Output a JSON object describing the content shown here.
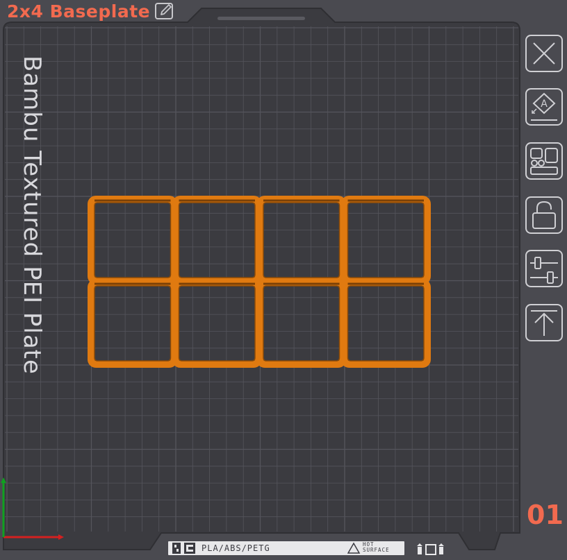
{
  "window": {
    "title": "2x4 Baseplate",
    "title_color": "#f26a4f"
  },
  "plate": {
    "name": "Bambu Textured PEI Plate",
    "index": "01",
    "index_color": "#f26a4f",
    "bed_color": "#3b3b40",
    "grid_color": "#55555c",
    "model_color": "#e07a10",
    "model_name": "2x4 Baseplate",
    "model_rows": 2,
    "model_cols": 4
  },
  "side_toolbar": [
    {
      "name": "close-plate-button",
      "icon": "close-icon"
    },
    {
      "name": "auto-orient-button",
      "icon": "auto-orient-icon"
    },
    {
      "name": "arrange-button",
      "icon": "arrange-icon"
    },
    {
      "name": "lock-plate-button",
      "icon": "lock-icon"
    },
    {
      "name": "plate-settings-button",
      "icon": "settings-sliders-icon"
    },
    {
      "name": "move-to-top-button",
      "icon": "move-to-top-icon"
    }
  ],
  "bottom_label": {
    "material": "PLA/ABS/PETG",
    "hot_line1": "HOT",
    "hot_line2": "SURFACE"
  },
  "axes": {
    "x_color": "#d42020",
    "y_color": "#10a020"
  }
}
